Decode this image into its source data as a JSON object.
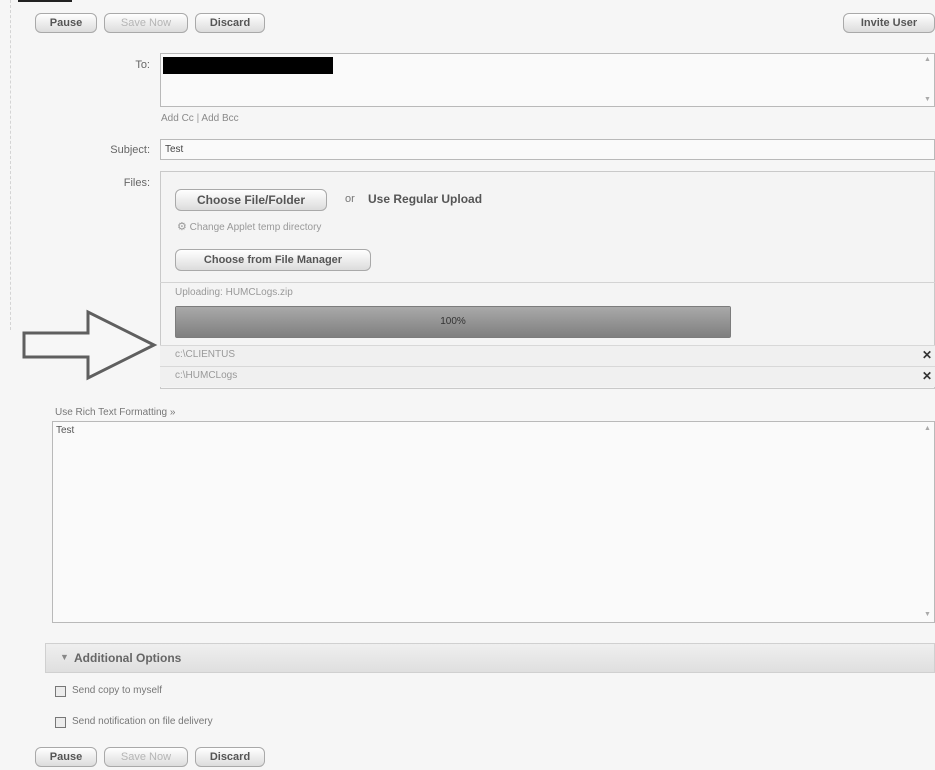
{
  "top_toolbar": {
    "pause": "Pause",
    "save_now": "Save Now",
    "discard": "Discard",
    "invite_user": "Invite User"
  },
  "compose": {
    "to_label": "To:",
    "add_cc": "Add Cc",
    "separator": "|",
    "add_bcc": "Add Bcc",
    "subject_label": "Subject:",
    "subject_value": "Test",
    "files_label": "Files:"
  },
  "upload": {
    "choose_file_folder": "Choose File/Folder",
    "or": "or",
    "regular_upload": "Use Regular Upload",
    "change_temp": "Change Applet temp directory",
    "file_manager": "Choose from File Manager",
    "uploading": "Uploading: HUMCLogs.zip",
    "progress_text": "100%",
    "progress_fraction": 1.0,
    "files": [
      "c:\\CLIENTUS",
      "c:\\HUMCLogs"
    ]
  },
  "message": {
    "rich_text_link": "Use Rich Text Formatting »",
    "body": "Test"
  },
  "additional_options": {
    "title": "Additional Options",
    "send_copy": "Send copy to myself",
    "send_notification": "Send notification on file delivery"
  },
  "bottom_toolbar": {
    "pause": "Pause",
    "save_now": "Save Now",
    "discard": "Discard"
  }
}
